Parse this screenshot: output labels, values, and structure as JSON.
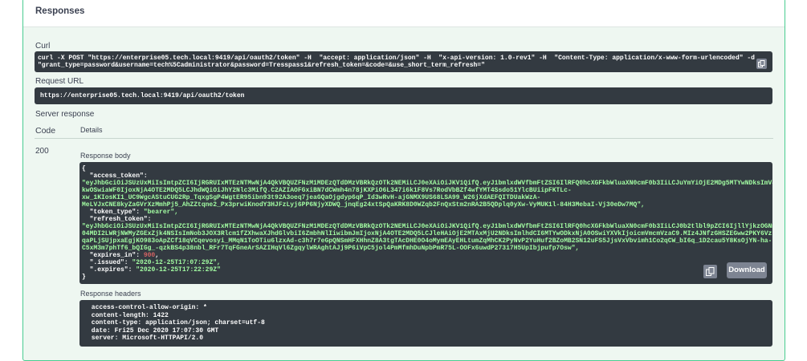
{
  "responses_title": "Responses",
  "curl": {
    "label": "Curl",
    "line1": "curl -X POST \"https://enterprise05.tech.local:9419/api/oauth2/token\" -H  \"accept: application/json\" -H  \"x-api-version: 1.0-rev1\" -H  \"Content-Type: application/x-www-form-urlencoded\" -d",
    "line2": "\"grant_type=password&username=tech%5Cadministrator&password=Tresspass1&refresh_token=&code=&use_short_term_refresh=\""
  },
  "request_url": {
    "label": "Request URL",
    "value": "https://enterprise05.tech.local:9419/api/oauth2/token"
  },
  "server_response": {
    "label": "Server response",
    "code_header": "Code",
    "details_header": "Details",
    "code": "200",
    "body_label": "Response body",
    "headers_label": "Response headers"
  },
  "response_body": {
    "open_brace": "{",
    "access_token_key": "  \"access_token\":",
    "access_token_lines": [
      "\"eyJhbGciOiJSUzUxMiIsImtpZCI6IjRGRUIxMTEzNTMwNjA4QkVBQUZFNzM1MDEzQTdDMzVBRkQzOTk2NEMiLCJ0eXAiOiJKV1QifQ.eyJ1bmlxdWVfbmFtZSI6IlRFQ0hcXGFkbWluaXN0cmF0b3IiLCJuYmYiOjE2MDg5MTYwNDksImV4cCI6MTYwODkxNj",
      "kwOSwiaWF0IjoxNjA4OTE2MDQ5LCJhdWQiOiJhY2Nlc3MifQ.C2AZIAOFGxiBN7dCWmh4n78jKXPiO6L347i6k1F8Vs7RodVbBZf4wfYMT4Ssdo51YlcBUiipFKTLc-",
      "xw_1KIosKI1_UC9WgcAStuCUG2Rp_TqxgSgP4WgtER95ibn93t92A3oeq7jeaGQaOjgdyp6qP_Id3wRvH-ajGNMX9US68LSA99_W26jXdAEFQITDUakWzA-",
      "MeLVJxCNE8kyZaGVrXzMmhPj5_AhZZtqne2_Px3prwiKnodY3HJFzLyj6PP6NjyXDWQ_jnqEg24xtSpQaKRK8D0WZqb2FnQxStm2nRA2B5QDplq0yXw-VyMUK1l-84H3MebaI-Vj30eDw7MQ\","
    ],
    "token_type_key": "  \"token_type\":",
    "token_type_value": "\"bearer\",",
    "refresh_token_key": "  \"refresh_token\":",
    "refresh_token_lines": [
      "\"eyJhbGciOiJSUzUxMiIsImtpZCI6IjRGRUIxMTEzNTMwNjA4QkVBQUZFNzM1MDEzQTdDMzVBRkQzOTk2NEMiLCJ0eXAiOiJKV1QifQ.eyJ1bmlxdWVfbmFtZSI6IlRFQ0hcXGFkbWluaXN0cmF0b3IiLCJ0b2tlbl9pZCI6IjllYjkzOGNmLTUzMmYtNGI5OC",
      "04MDI2LWRjNWMyZGExZjk4NSIsImNob3JOX3Rlcm1fZXhwaXJhdGlvbiI6ZmbhNlIiwibmJmIjoxNjA4OTE2MDQ5LCJleHAiOjE2MTAxMjU2NDksImlhdCI6MTYwODkxNjA0OSwiYXVkIjoicmVmcmVzaC9.MIz4JNfzGHSZEGww2PKY6VzlOsCi0_QCXoL",
      "qaPLjSUjpxaEgjKO983oApZCf18qVCqevosyi_MMqN1ToOTiu6lzxAd-c3h7r7eGpQNSmHFXHhnZ8A3tgTAcDHE0O4oMymEAyEHLtumZqMhCK2PyNvP2YuHuf2BZoMB2SN12uFS5JjsVxVbvimh1Co2qCW_bI6q_1D2cau5Y8KsOjYN-ha-",
      "C5xM3m7phTf6_bQIGg_-qzkBS4p38nbl_RFr7TqFGneArSAZIHqVl6ZgqylWRAghtAJj9P6iVpC5jol4PmMfmhDuNpbPmR75L-OOFx6uwdP27317H5UpIbjpufp7Osw\","
    ],
    "expires_in_key": "  \"expires_in\":",
    "expires_in_value": "900",
    "issued_key": "  \".issued\":",
    "issued_value": "\"2020-12-25T17:07:29Z\",",
    "expires_key": "  \".expires\":",
    "expires_value": "\"2020-12-25T17:22:29Z\"",
    "close_brace": "}"
  },
  "download_label": "Download",
  "response_headers": [
    " access-control-allow-origin: * ",
    " content-length: 1422 ",
    " content-type: application/json; charset=utf-8 ",
    " date: Fri25 Dec 2020 17:07:30 GMT ",
    " server: Microsoft-HTTPAPI/2.0 "
  ]
}
